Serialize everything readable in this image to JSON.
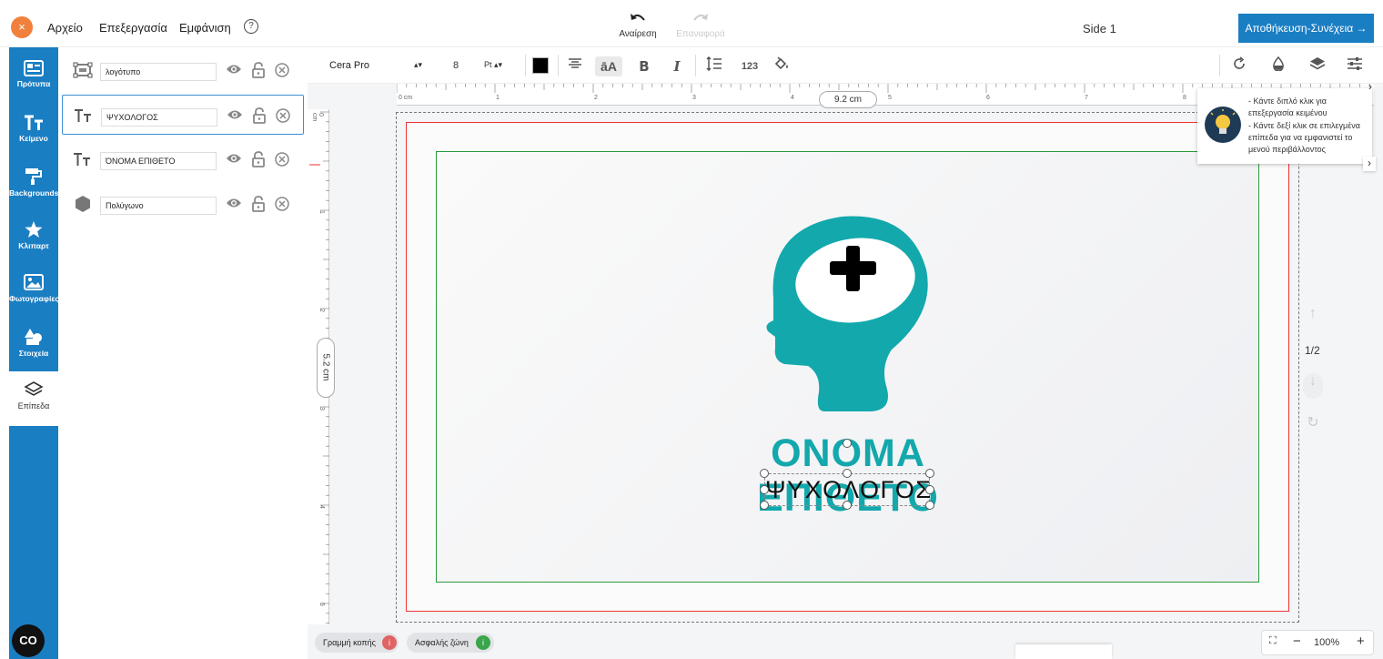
{
  "header": {
    "menu": [
      "Αρχείο",
      "Επεξεργασία",
      "Εμφάνιση"
    ],
    "undo_label": "Αναίρεση",
    "redo_label": "Επαναφορά",
    "side_title": "Side 1",
    "save_label": "Αποθήκευση-Συνέχεια →",
    "close_label": "×",
    "help_label": "?"
  },
  "sidebar": {
    "items": [
      {
        "label": "Πρότυπα",
        "icon": "templates-icon"
      },
      {
        "label": "Κείμενο",
        "icon": "text-icon"
      },
      {
        "label": "Backgrounds",
        "icon": "paint-roller-icon"
      },
      {
        "label": "Κλιπαρτ",
        "icon": "star-icon"
      },
      {
        "label": "Φωτογραφίες",
        "icon": "photo-icon"
      },
      {
        "label": "Στοιχεία",
        "icon": "shapes-icon"
      }
    ],
    "layers_label": "Επίπεδα",
    "co_label": "CO"
  },
  "layers": [
    {
      "name": "λογότυπο",
      "type": "image"
    },
    {
      "name": "ΨΥΧΟΛΟΓΟΣ",
      "type": "text",
      "selected": true
    },
    {
      "name": "ΌΝΟΜΑ ΕΠΙΘΕΤΟ",
      "type": "text"
    },
    {
      "name": "Πολύγωνο",
      "type": "shape"
    }
  ],
  "toolbar": {
    "font": "Cera Pro",
    "font_size": "8",
    "unit": "Pt",
    "text_color": "#000000",
    "case_glyph": "āA",
    "bold_glyph": "B",
    "italic_glyph": "I",
    "numbers_glyph": "123"
  },
  "rulers": {
    "h_labels": [
      "0 cm",
      "1",
      "2",
      "3",
      "4",
      "5",
      "6",
      "7",
      "8"
    ],
    "v_labels": [
      "0 cm",
      "1",
      "2",
      "3",
      "4",
      "5"
    ],
    "h_readout": "9.2 cm",
    "v_readout": "5.2 cm"
  },
  "design": {
    "name": "ΟΝΟΜΑ ΕΠΙΘΕΤΟ",
    "profession": "ΨΥΧΟΛΟΓΟΣ",
    "brand_color": "#13a8ac",
    "cut_line_color": "#e33333",
    "safe_zone_color": "#2a9a3a"
  },
  "tip": {
    "line1": "- Κάντε διπλό κλικ για επεξεργασία κειμένου",
    "line2": "- Κάντε δεξί κλικ σε επιλεγμένα επίπεδα για να εμφανιστεί το μενού περιβάλλοντος"
  },
  "pager": "1/2",
  "bottom": {
    "cut_line_label": "Γραμμή κοπής",
    "safe_zone_label": "Ασφαλής ζώνη",
    "zoom": "100%"
  }
}
